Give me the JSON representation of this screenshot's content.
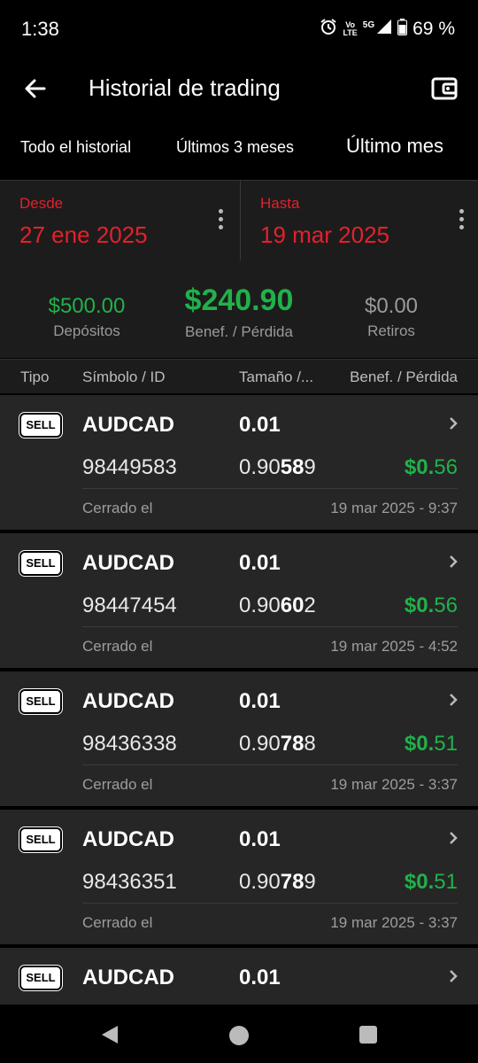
{
  "status_bar": {
    "time": "1:38",
    "volte_top": "Vo",
    "volte_bottom": "LTE",
    "network": "5G",
    "battery": "69 %"
  },
  "app_bar": {
    "title": "Historial de trading"
  },
  "tabs": [
    {
      "label": "Todo el historial"
    },
    {
      "label": "Últimos 3 meses"
    },
    {
      "label": "Último mes",
      "active": true
    }
  ],
  "date_range": {
    "from_label": "Desde",
    "from_value": "27 ene 2025",
    "to_label": "Hasta",
    "to_value": "19 mar 2025"
  },
  "summary": {
    "deposits_value": "$500.00",
    "deposits_label": "Depósitos",
    "pl_value": "$240.90",
    "pl_label": "Benef. / Pérdida",
    "withdrawals_value": "$0.00",
    "withdrawals_label": "Retiros"
  },
  "columns": {
    "type": "Tipo",
    "symbol": "Símbolo / ID",
    "size": "Tamaño /...",
    "pl": "Benef. / Pérdida"
  },
  "trades": [
    {
      "type": "SELL",
      "symbol": "AUDCAD",
      "size": "0.01",
      "id": "98449583",
      "price_pre": "0.90",
      "price_bold": "58",
      "price_post": "9",
      "pl_bold": "$0.",
      "pl_rest": "56",
      "closed_label": "Cerrado el",
      "closed_time": "19 mar 2025 - 9:37"
    },
    {
      "type": "SELL",
      "symbol": "AUDCAD",
      "size": "0.01",
      "id": "98447454",
      "price_pre": "0.90",
      "price_bold": "60",
      "price_post": "2",
      "pl_bold": "$0.",
      "pl_rest": "56",
      "closed_label": "Cerrado el",
      "closed_time": "19 mar 2025 - 4:52"
    },
    {
      "type": "SELL",
      "symbol": "AUDCAD",
      "size": "0.01",
      "id": "98436338",
      "price_pre": "0.90",
      "price_bold": "78",
      "price_post": "8",
      "pl_bold": "$0.",
      "pl_rest": "51",
      "closed_label": "Cerrado el",
      "closed_time": "19 mar 2025 - 3:37"
    },
    {
      "type": "SELL",
      "symbol": "AUDCAD",
      "size": "0.01",
      "id": "98436351",
      "price_pre": "0.90",
      "price_bold": "78",
      "price_post": "9",
      "pl_bold": "$0.",
      "pl_rest": "51",
      "closed_label": "Cerrado el",
      "closed_time": "19 mar 2025 - 3:37"
    },
    {
      "type": "SELL",
      "symbol": "AUDCAD",
      "size": "0.01"
    }
  ],
  "colors": {
    "accent_red": "#e3212b",
    "profit_green": "#21b14a",
    "background": "#000000",
    "card": "#262626",
    "panel": "#1c1c1c"
  }
}
